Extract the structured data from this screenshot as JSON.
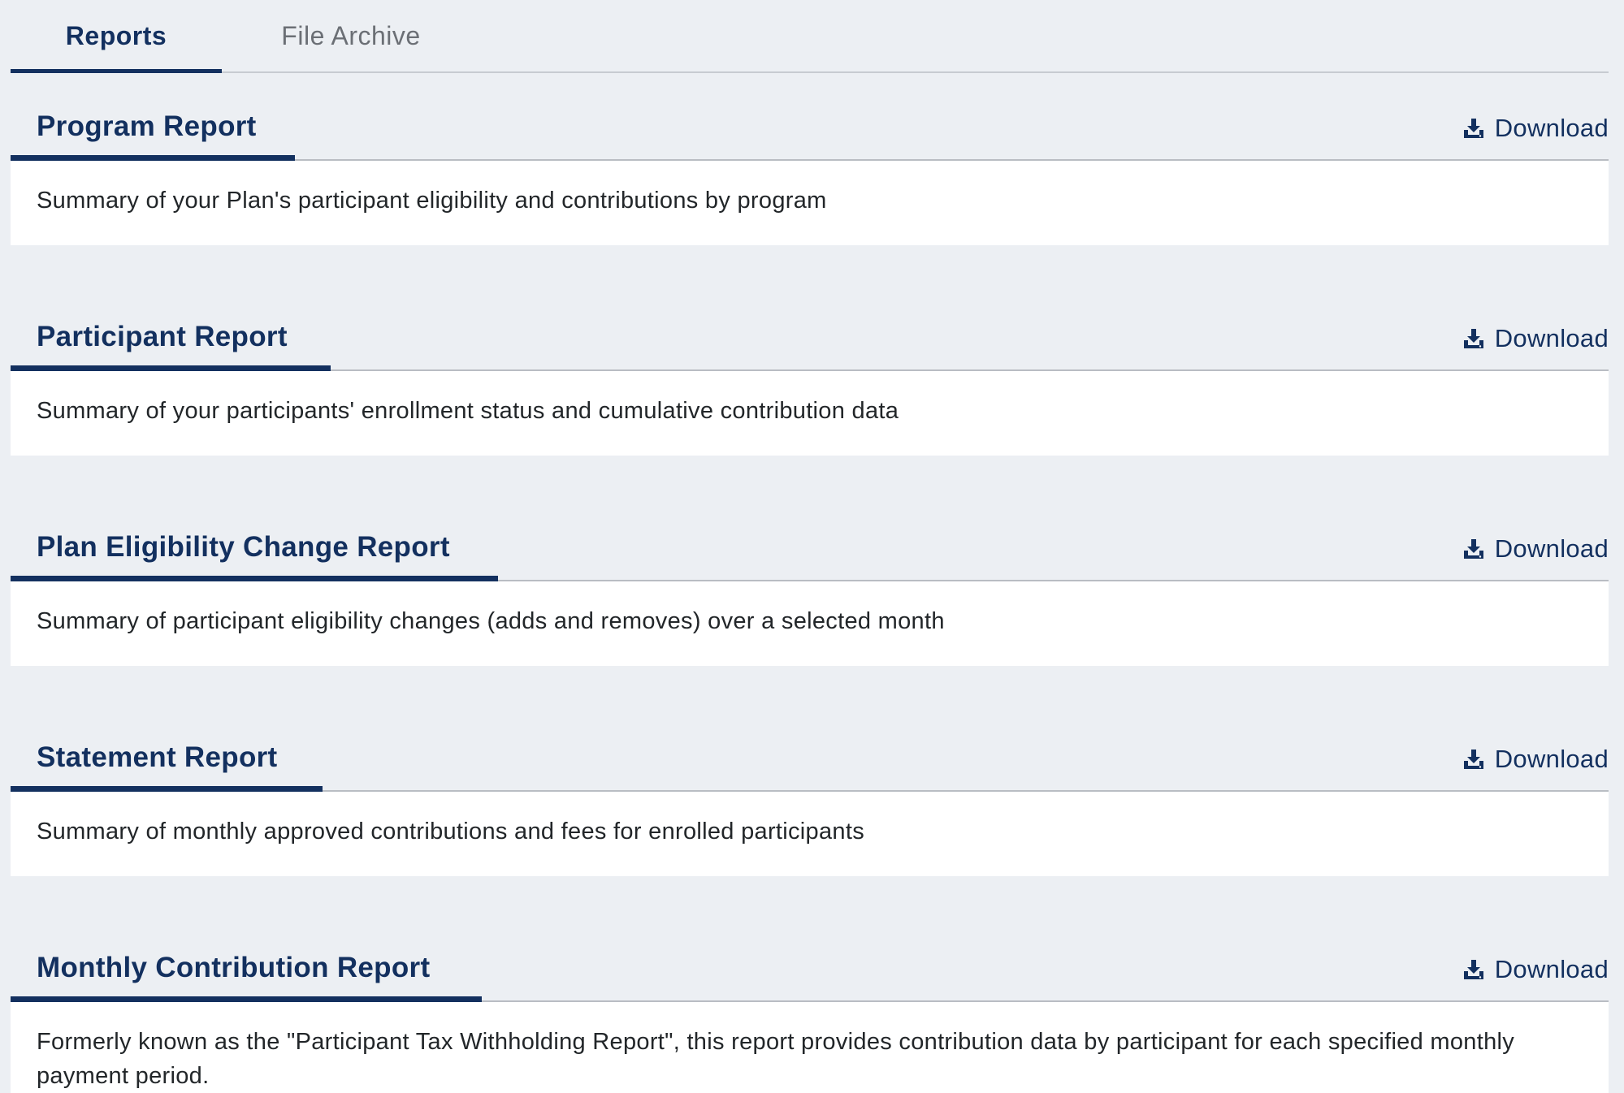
{
  "tabs": [
    {
      "label": "Reports",
      "active": true
    },
    {
      "label": "File Archive",
      "active": false
    }
  ],
  "download_label": "Download",
  "icons": {
    "download": "download-tray-icon"
  },
  "colors": {
    "accent": "#13305f",
    "background": "#eceff3",
    "card": "#ffffff",
    "inactive_tab": "#6b6f75"
  },
  "reports": [
    {
      "title": "Program Report",
      "description": "Summary of your Plan's participant eligibility and contributions by program"
    },
    {
      "title": "Participant Report",
      "description": "Summary of your participants' enrollment status and cumulative contribution data"
    },
    {
      "title": "Plan Eligibility Change Report",
      "description": "Summary of participant eligibility changes (adds and removes) over a selected month"
    },
    {
      "title": "Statement Report",
      "description": "Summary of monthly approved contributions and fees for enrolled participants"
    },
    {
      "title": "Monthly Contribution Report",
      "description": "Formerly known as the \"Participant Tax Withholding Report\", this report provides contribution data by participant for each specified monthly payment period."
    }
  ]
}
